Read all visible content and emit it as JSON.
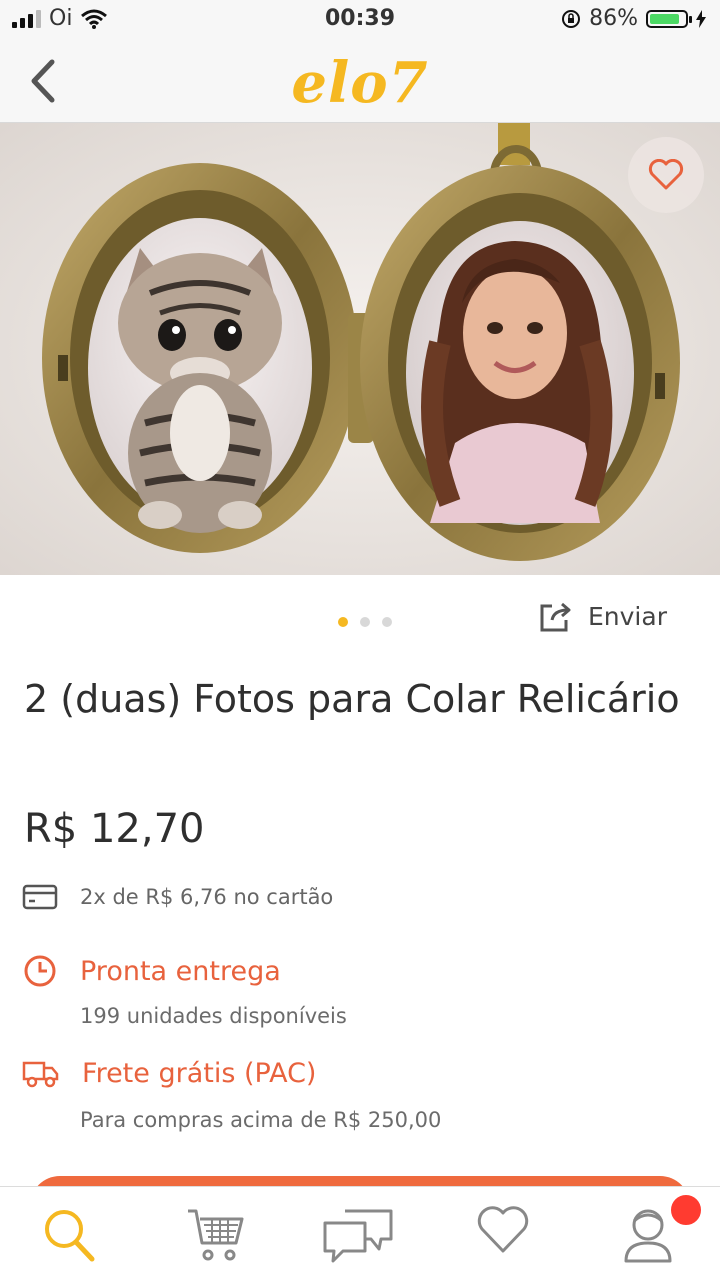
{
  "status_bar": {
    "carrier": "Oi",
    "time": "00:39",
    "battery": "86%",
    "battery_level": 0.86
  },
  "nav": {
    "logo": "elo7"
  },
  "gallery": {
    "images": [
      "locket-photo"
    ],
    "current_index": 0,
    "total": 3
  },
  "share": {
    "label": "Enviar"
  },
  "product": {
    "title": "2 (duas) Fotos para Colar Relicário",
    "price": "R$ 12,70",
    "installments": "2x de R$ 6,76 no cartão",
    "availability": {
      "label": "Pronta entrega",
      "detail": "199 unidades disponíveis"
    },
    "shipping": {
      "label": "Frete grátis (PAC)",
      "detail": "Para compras acima de R$ 250,00"
    }
  },
  "colors": {
    "accent": "#f5b821",
    "orange": "#e8623d",
    "cta": "#ef6a3e",
    "badge": "#ff3b30"
  },
  "tabbar": {
    "items": [
      {
        "icon": "search-icon",
        "active": true
      },
      {
        "icon": "cart-icon",
        "active": false
      },
      {
        "icon": "chat-icon",
        "active": false
      },
      {
        "icon": "heart-icon",
        "active": false
      },
      {
        "icon": "profile-icon",
        "active": false,
        "has_badge": true
      }
    ]
  }
}
